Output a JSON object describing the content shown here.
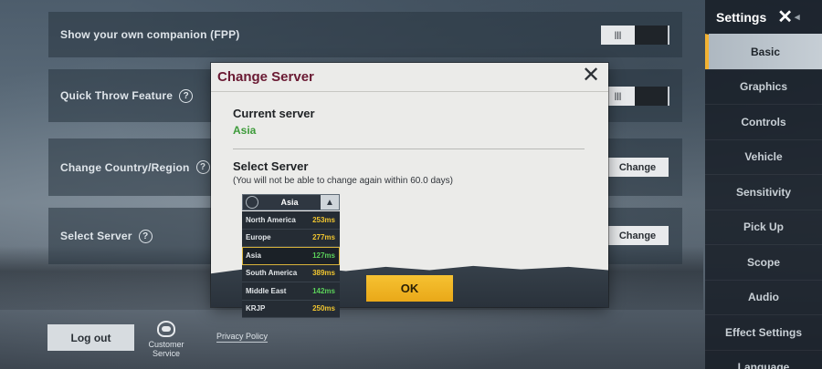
{
  "settings_rows": [
    {
      "label": "Show your own companion (FPP)",
      "control": "toggle"
    },
    {
      "label": "Quick Throw Feature",
      "control": "toggle"
    },
    {
      "label": "Change Country/Region",
      "control": "button",
      "button_label": "Change"
    },
    {
      "label": "Select Server",
      "control": "button",
      "button_label": "Change"
    }
  ],
  "toggle_on_label": "|||",
  "help_glyph": "?",
  "sidebar": {
    "title": "Settings",
    "close_glyph": "✕",
    "back_glyph": "◂",
    "items": [
      "Basic",
      "Graphics",
      "Controls",
      "Vehicle",
      "Sensitivity",
      "Pick Up",
      "Scope",
      "Audio",
      "Effect Settings",
      "Language"
    ],
    "active": "Basic"
  },
  "footer": {
    "logout_label": "Log out",
    "customer_service_label": "Customer Service",
    "privacy_label": "Privacy Policy"
  },
  "dialog": {
    "title": "Change Server",
    "close_glyph": "✕",
    "current_server_title": "Current server",
    "current_server_value": "Asia",
    "select_server_title": "Select Server",
    "select_server_note": "(You will not be able to change again within 60.0 days)",
    "ok_label": "OK",
    "dropdown": {
      "selected": "Asia",
      "chevron_glyph": "▲",
      "options": [
        {
          "name": "North America",
          "ping": "253ms",
          "ping_color": "yellow"
        },
        {
          "name": "Europe",
          "ping": "277ms",
          "ping_color": "yellow"
        },
        {
          "name": "Asia",
          "ping": "127ms",
          "ping_color": "green"
        },
        {
          "name": "South America",
          "ping": "389ms",
          "ping_color": "yellow"
        },
        {
          "name": "Middle East",
          "ping": "142ms",
          "ping_color": "green"
        },
        {
          "name": "KRJP",
          "ping": "250ms",
          "ping_color": "yellow"
        }
      ]
    }
  },
  "colors": {
    "dialog_title": "#6a1a33",
    "current_server_value": "#3d9b3a",
    "ok_button": "#f6c232",
    "ping_yellow": "#f0c530",
    "ping_green": "#5bd15a",
    "sidebar_active_accent": "#f2b233"
  }
}
